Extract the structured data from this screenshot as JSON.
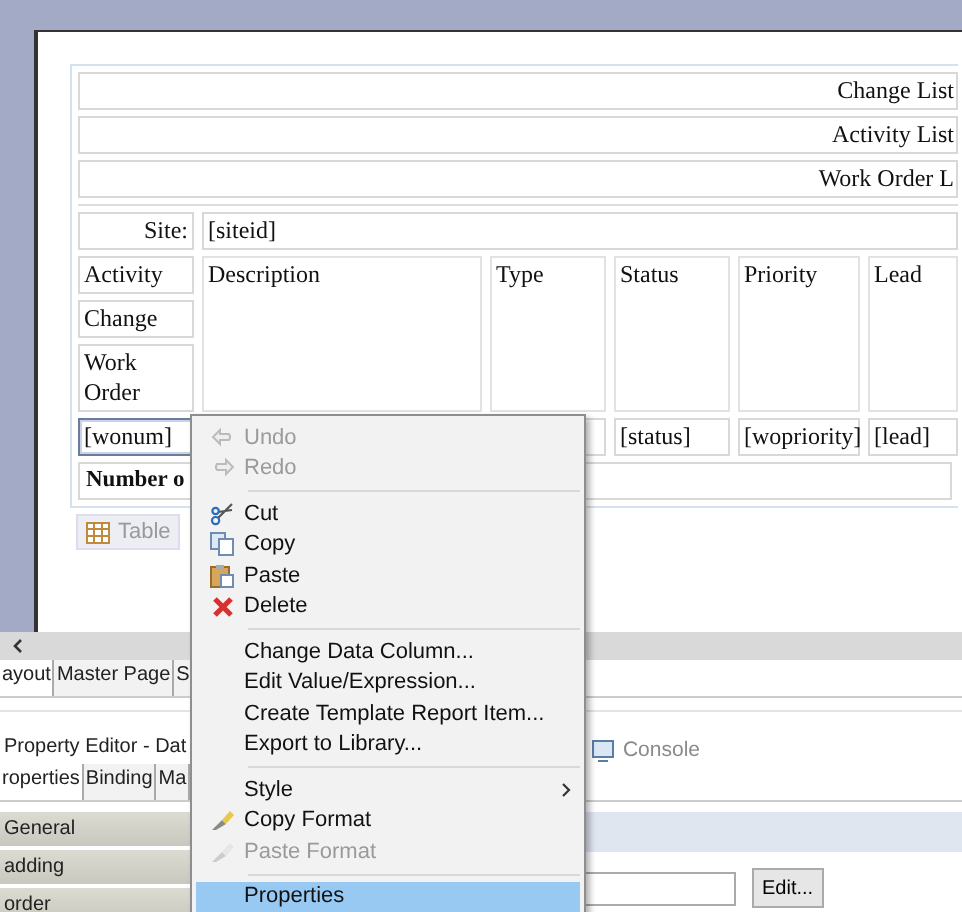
{
  "report_table": {
    "title_rows": [
      "Change List",
      "Activity List",
      "Work Order L"
    ],
    "site_label": "Site:",
    "site_value": "[siteid]",
    "header_columns": [
      "Activity",
      "Description",
      "Type",
      "Status",
      "Priority",
      "Lead"
    ],
    "activity_subheaders": [
      "Change",
      "Work Order"
    ],
    "data_row": [
      {
        "text": "[wonum]",
        "selected": true
      },
      {
        "text": "[status]",
        "selected": false
      },
      {
        "text": "[wopriority]",
        "selected": false
      },
      {
        "text": "[lead]",
        "selected": false
      }
    ],
    "footer_label": "Number o",
    "table_tab": "Table"
  },
  "editor_tabs": [
    {
      "label": "ayout",
      "selected": true
    },
    {
      "label": "Master Page",
      "selected": false
    },
    {
      "label": "S",
      "selected": false
    }
  ],
  "property_editor": {
    "title": "Property Editor - Dat",
    "console_tab": "Console",
    "tabs": [
      {
        "label": "roperties",
        "selected": true
      },
      {
        "label": "Binding",
        "selected": false
      },
      {
        "label": "Ma",
        "selected": false
      }
    ],
    "categories": [
      "General",
      "adding",
      "order"
    ],
    "edit_button": "Edit..."
  },
  "context_menu": [
    {
      "kind": "item",
      "label": "Undo",
      "disabled": true,
      "selected": false
    },
    {
      "kind": "item",
      "label": "Redo",
      "disabled": true,
      "selected": false
    },
    {
      "kind": "separator"
    },
    {
      "kind": "item",
      "label": "Cut",
      "disabled": false,
      "selected": false
    },
    {
      "kind": "item",
      "label": "Copy",
      "disabled": false,
      "selected": false
    },
    {
      "kind": "item",
      "label": "Paste",
      "disabled": false,
      "selected": false
    },
    {
      "kind": "item",
      "label": "Delete",
      "disabled": false,
      "selected": false
    },
    {
      "kind": "separator"
    },
    {
      "kind": "item",
      "label": "Change Data Column...",
      "disabled": false,
      "selected": false
    },
    {
      "kind": "item",
      "label": "Edit Value/Expression...",
      "disabled": false,
      "selected": false
    },
    {
      "kind": "item",
      "label": "Create Template Report Item...",
      "disabled": false,
      "selected": false
    },
    {
      "kind": "item",
      "label": "Export to Library...",
      "disabled": false,
      "selected": false
    },
    {
      "kind": "separator"
    },
    {
      "kind": "submenu",
      "label": "Style",
      "disabled": false,
      "selected": false
    },
    {
      "kind": "item",
      "label": "Copy Format",
      "disabled": false,
      "selected": false
    },
    {
      "kind": "item",
      "label": "Paste Format",
      "disabled": true,
      "selected": false
    },
    {
      "kind": "separator"
    },
    {
      "kind": "item",
      "label": "Properties",
      "disabled": false,
      "selected": true
    }
  ]
}
